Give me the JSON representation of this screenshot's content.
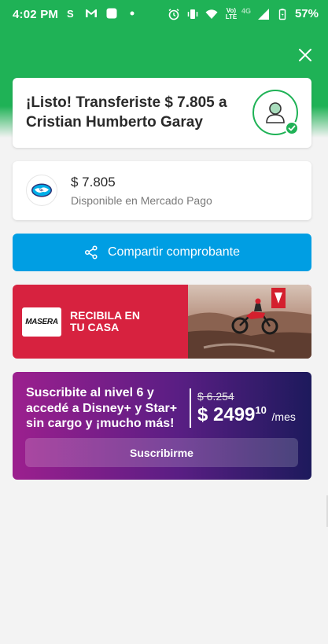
{
  "status_bar": {
    "time": "4:02 PM",
    "network_top": "Vo)",
    "network_bottom": "LTE",
    "network_gen": "4G",
    "battery": "57%"
  },
  "success": {
    "title": "¡Listo! Transferiste $ 7.805 a Cristian Humberto Garay"
  },
  "balance": {
    "amount": "$ 7.805",
    "subtitle": "Disponible en Mercado Pago"
  },
  "share": {
    "label": "Compartir comprobante"
  },
  "promo": {
    "brand": "MASERA",
    "text": "RECIBILA EN TU CASA"
  },
  "subscription": {
    "text": "Suscribite al nivel 6 y accedé a Disney+ y Star+ sin cargo y ¡mucho más!",
    "old_price": "$ 6.254",
    "new_price_main": "$ 2499",
    "new_price_cents": "10",
    "new_price_period": "/mes",
    "button_label": "Suscribirme"
  },
  "colors": {
    "brand_green": "#1fb256",
    "action_blue": "#009ee3",
    "promo_red": "#d7223f"
  },
  "icons": {
    "close": "close-icon",
    "share": "share-icon",
    "user": "user-icon",
    "check": "check-icon",
    "mercadopago": "mercadopago-logo"
  }
}
